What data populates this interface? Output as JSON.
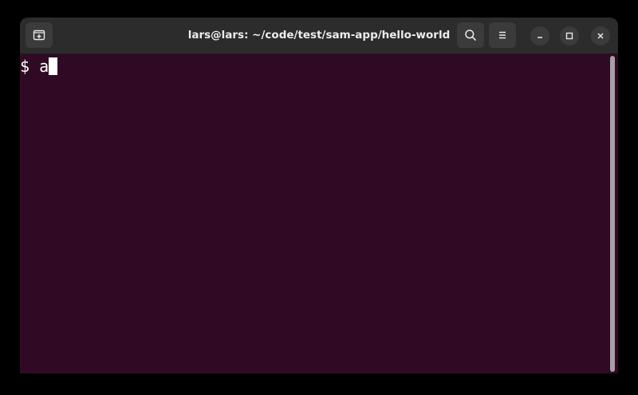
{
  "window": {
    "title": "lars@lars: ~/code/test/sam-app/hello-world"
  },
  "terminal": {
    "prompt": "$ ",
    "input": "a"
  },
  "icons": {
    "new_tab": "new-tab-icon",
    "search": "search-icon",
    "menu": "hamburger-menu-icon",
    "minimize": "minimize-icon",
    "maximize": "maximize-icon",
    "close": "close-icon"
  },
  "colors": {
    "terminal_background": "#300a24",
    "headerbar": "#2c2c2c",
    "text": "#ffffff"
  }
}
